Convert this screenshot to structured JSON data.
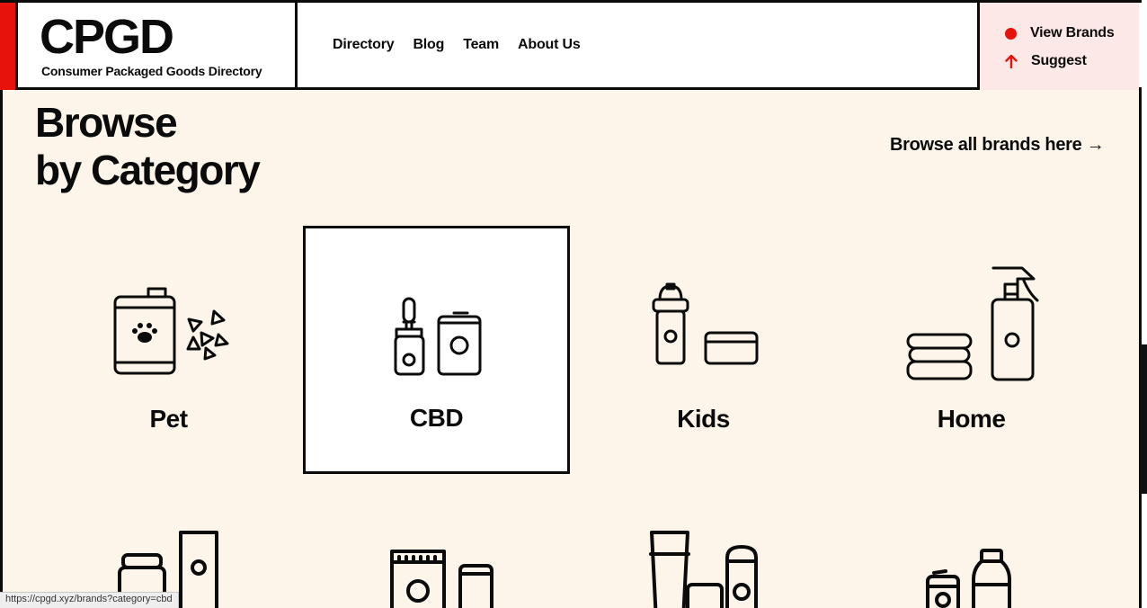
{
  "header": {
    "logo_title": "CPGD",
    "logo_subtitle": "Consumer Packaged Goods Directory",
    "nav": [
      "Directory",
      "Blog",
      "Team",
      "About Us"
    ],
    "actions": [
      {
        "label": "View Brands",
        "icon": "red-dot-icon"
      },
      {
        "label": "Suggest",
        "icon": "arrow-up-icon"
      }
    ]
  },
  "main": {
    "heading_line1": "Browse",
    "heading_line2": "by Category",
    "browse_all": "Browse all brands here →",
    "categories": [
      {
        "label": "Pet",
        "icon": "pet-food-icon",
        "selected": false
      },
      {
        "label": "CBD",
        "icon": "cbd-dropper-icon",
        "selected": true
      },
      {
        "label": "Kids",
        "icon": "baby-bottle-icon",
        "selected": false
      },
      {
        "label": "Home",
        "icon": "spray-bottle-icon",
        "selected": false
      }
    ]
  },
  "status_bar": {
    "url": "https://cpgd.xyz/brands?category=cbd"
  },
  "colors": {
    "accent": "#e8120c",
    "background": "#fdf5ea",
    "actions_bg": "#fce8e6",
    "ink": "#0b0b0b"
  }
}
